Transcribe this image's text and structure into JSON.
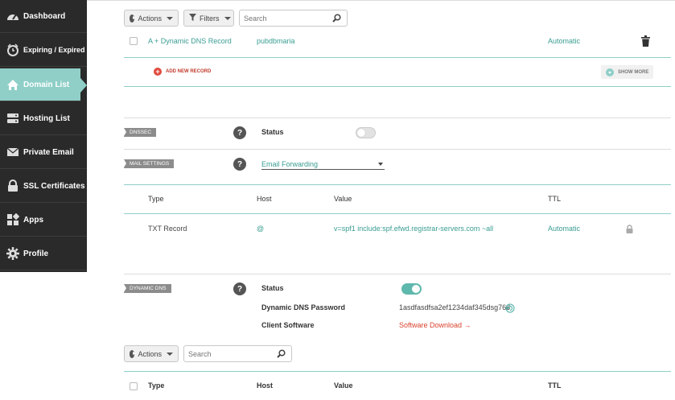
{
  "sidebar": {
    "items": [
      {
        "label": "Dashboard",
        "icon": "gauge-icon"
      },
      {
        "label": "Expiring / Expired",
        "icon": "clock-icon"
      },
      {
        "label": "Domain List",
        "icon": "home-icon"
      },
      {
        "label": "Hosting List",
        "icon": "server-icon"
      },
      {
        "label": "Private Email",
        "icon": "envelope-icon"
      },
      {
        "label": "SSL Certificates",
        "icon": "lock-icon"
      },
      {
        "label": "Apps",
        "icon": "apps-icon"
      },
      {
        "label": "Profile",
        "icon": "gear-icon"
      }
    ],
    "active_index": 2
  },
  "toolbar1": {
    "actions_label": "Actions",
    "filters_label": "Filters",
    "search_placeholder": "Search"
  },
  "record_row": {
    "type": "A + Dynamic DNS Record",
    "host": "pubdbmaria",
    "ttl": "Automatic"
  },
  "add_new_record_label": "ADD NEW RECORD",
  "show_more_label": "SHOW MORE",
  "dnssec": {
    "tag": "DNSSEC",
    "help": "?",
    "status_label": "Status",
    "enabled": false
  },
  "mail": {
    "tag": "MAIL SETTINGS",
    "help": "?",
    "selected": "Email Forwarding"
  },
  "mail_table": {
    "headers": [
      "Type",
      "Host",
      "Value",
      "TTL"
    ],
    "row": {
      "type": "TXT Record",
      "host": "@",
      "value": "v=spf1 include:spf.efwd.registrar-servers.com ~all",
      "ttl": "Automatic"
    }
  },
  "ddns": {
    "tag": "DYNAMIC DNS",
    "help": "?",
    "status_label": "Status",
    "enabled": true,
    "password_label": "Dynamic DNS Password",
    "password_value": "1asdfasdfsa2ef1234daf345dsg768",
    "software_label": "Client Software",
    "software_link": "Software Download →"
  },
  "toolbar2": {
    "actions_label": "Actions",
    "search_placeholder": "Search"
  },
  "ddns_table": {
    "headers": [
      "Type",
      "Host",
      "Value",
      "TTL"
    ]
  },
  "colors": {
    "accent": "#8fcfc8",
    "sidebar_bg": "#2a2a2a",
    "link": "#3a9d92",
    "danger": "#d9432f"
  }
}
